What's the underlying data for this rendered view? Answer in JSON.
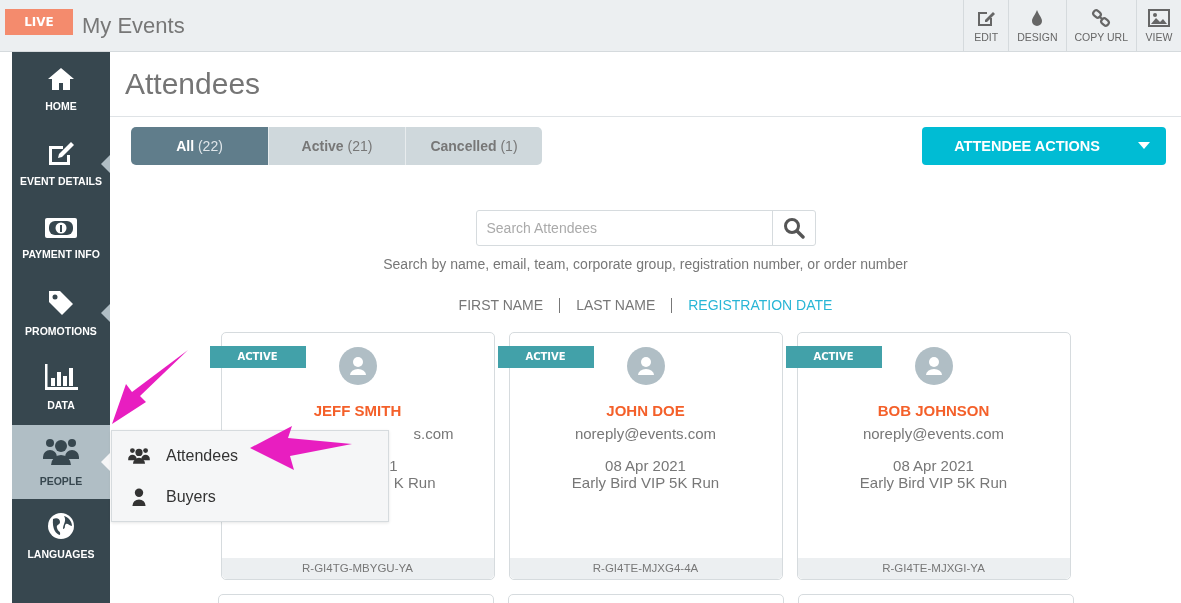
{
  "header": {
    "badge": "LIVE",
    "title": "My Events",
    "tools": [
      {
        "label": "EDIT"
      },
      {
        "label": "DESIGN"
      },
      {
        "label": "COPY URL"
      },
      {
        "label": "VIEW"
      }
    ]
  },
  "sidebar": {
    "items": [
      {
        "label": "HOME",
        "selected": false,
        "marker": false
      },
      {
        "label": "EVENT DETAILS",
        "selected": false,
        "marker": true
      },
      {
        "label": "PAYMENT INFO",
        "selected": false,
        "marker": false
      },
      {
        "label": "PROMOTIONS",
        "selected": false,
        "marker": true
      },
      {
        "label": "DATA",
        "selected": false,
        "marker": false
      },
      {
        "label": "PEOPLE",
        "selected": true,
        "marker": true
      },
      {
        "label": "LANGUAGES",
        "selected": false,
        "marker": false
      }
    ]
  },
  "submenu": {
    "items": [
      {
        "label": "Attendees"
      },
      {
        "label": "Buyers"
      }
    ]
  },
  "page": {
    "title": "Attendees",
    "tabs": [
      {
        "label": "All",
        "count": "(22)",
        "selected": true
      },
      {
        "label": "Active",
        "count": "(21)",
        "selected": false
      },
      {
        "label": "Cancelled",
        "count": "(1)",
        "selected": false
      }
    ],
    "actions_button": "ATTENDEE ACTIONS",
    "search": {
      "placeholder": "Search Attendees",
      "hint": "Search by name, email, team, corporate group, registration number, or order number"
    },
    "sort": [
      {
        "label": "FIRST NAME",
        "selected": false
      },
      {
        "label": "LAST NAME",
        "selected": false
      },
      {
        "label": "REGISTRATION DATE",
        "selected": true
      }
    ],
    "cards": [
      {
        "status": "ACTIVE",
        "name": "JEFF SMITH",
        "email": "s.com",
        "date": "1",
        "ticket": "K Run",
        "code": "R-GI4TG-MBYGU-YA",
        "cut": true
      },
      {
        "status": "ACTIVE",
        "name": "JOHN DOE",
        "email": "noreply@events.com",
        "date": "08 Apr 2021",
        "ticket": "Early Bird VIP 5K Run",
        "code": "R-GI4TE-MJXG4-4A",
        "cut": false
      },
      {
        "status": "ACTIVE",
        "name": "BOB JOHNSON",
        "email": "noreply@events.com",
        "date": "08 Apr 2021",
        "ticket": "Early Bird VIP 5K Run",
        "code": "R-GI4TE-MJXGI-YA",
        "cut": false
      }
    ]
  }
}
